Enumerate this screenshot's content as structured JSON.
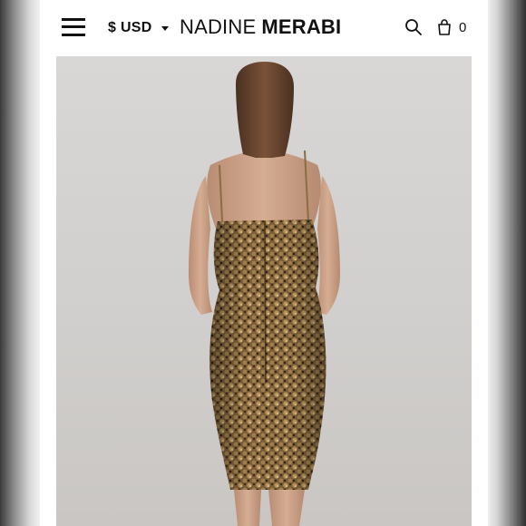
{
  "header": {
    "currency": "$ USD",
    "brand_light": "NADINE",
    "brand_bold": "MERABI",
    "cart_count": "0"
  },
  "icons": {
    "menu": "hamburger-icon",
    "currency_toggle": "chevron-down-icon",
    "search": "search-icon",
    "cart": "shopping-bag-icon"
  },
  "colors": {
    "header_bg": "#ffffff",
    "text": "#111111",
    "photo_bg": "#d3d1cf",
    "dress_gold": "#8a6d45"
  }
}
